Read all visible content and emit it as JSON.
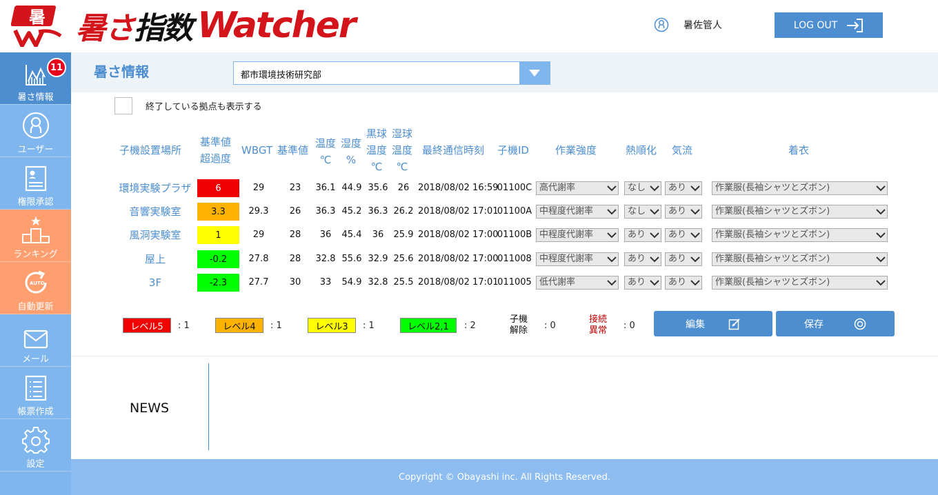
{
  "header": {
    "logo_kanji_red1": "暑",
    "logo_kana": "さ",
    "logo_kanji_black": "指数",
    "logo_en": "Watcher",
    "user_name": "暑佐管人",
    "logout_label": "LOG OUT"
  },
  "sidebar": {
    "items": [
      {
        "label": "暑さ情報",
        "badge": "11",
        "icon": "chart-icon"
      },
      {
        "label": "ユーザー",
        "icon": "user-icon"
      },
      {
        "label": "権限承認",
        "icon": "document-icon"
      },
      {
        "label": "ランキング",
        "icon": "podium-icon"
      },
      {
        "label": "自動更新",
        "icon": "auto-refresh-icon"
      },
      {
        "label": "メール",
        "icon": "mail-icon"
      },
      {
        "label": "帳票作成",
        "icon": "list-icon"
      },
      {
        "label": "設定",
        "icon": "gear-icon"
      }
    ]
  },
  "page": {
    "title": "暑さ情報",
    "site_select_value": "都市環境技術研究部",
    "show_ended_label": "終了している拠点も表示する"
  },
  "table": {
    "headers": {
      "location": "子機設置場所",
      "exceed_1": "基準値",
      "exceed_2": "超過度",
      "wbgt": "WBGT",
      "standard": "基準値",
      "temp_1": "温度",
      "temp_2": "℃",
      "humidity_1": "湿度",
      "humidity_2": "%",
      "globe_1": "黒球",
      "globe_2": "温度",
      "globe_3": "℃",
      "wet_1": "湿球",
      "wet_2": "温度",
      "wet_3": "℃",
      "last_comm": "最終通信時刻",
      "unit_id": "子機ID",
      "work_intensity": "作業強度",
      "acclimatization": "熱順化",
      "airflow": "気流",
      "clothing": "着衣"
    },
    "rows": [
      {
        "location": "環境実験プラザ",
        "exceed": "6",
        "level": "red",
        "wbgt": "29",
        "standard": "23",
        "temp": "36.1",
        "humidity": "44.9",
        "globe": "35.6",
        "wet": "26",
        "time": "2018/08/02 16:59",
        "id": "01100C",
        "intensity": "高代謝率",
        "acclim": "なし",
        "airflow": "あり",
        "clothing": "作業服(長袖シャツとズボン)"
      },
      {
        "location": "音響実験室",
        "exceed": "3.3",
        "level": "orange",
        "wbgt": "29.3",
        "standard": "26",
        "temp": "36.3",
        "humidity": "45.2",
        "globe": "36.3",
        "wet": "26.2",
        "time": "2018/08/02 17:01",
        "id": "01100A",
        "intensity": "中程度代謝率",
        "acclim": "なし",
        "airflow": "あり",
        "clothing": "作業服(長袖シャツとズボン)"
      },
      {
        "location": "風洞実験室",
        "exceed": "1",
        "level": "yellow",
        "wbgt": "29",
        "standard": "28",
        "temp": "36",
        "humidity": "45.4",
        "globe": "36",
        "wet": "25.9",
        "time": "2018/08/02 17:00",
        "id": "01100B",
        "intensity": "中程度代謝率",
        "acclim": "あり",
        "airflow": "あり",
        "clothing": "作業服(長袖シャツとズボン)"
      },
      {
        "location": "屋上",
        "exceed": "-0.2",
        "level": "green",
        "wbgt": "27.8",
        "standard": "28",
        "temp": "32.8",
        "humidity": "55.6",
        "globe": "32.9",
        "wet": "25.6",
        "time": "2018/08/02 17:00",
        "id": "011008",
        "intensity": "中程度代謝率",
        "acclim": "あり",
        "airflow": "あり",
        "clothing": "作業服(長袖シャツとズボン)"
      },
      {
        "location": "3F",
        "exceed": "-2.3",
        "level": "green",
        "wbgt": "27.7",
        "standard": "30",
        "temp": "33",
        "humidity": "54.9",
        "globe": "32.8",
        "wet": "25.5",
        "time": "2018/08/02 17:01",
        "id": "011005",
        "intensity": "低代謝率",
        "acclim": "あり",
        "airflow": "あり",
        "clothing": "作業服(長袖シャツとズボン)"
      }
    ]
  },
  "legend": {
    "level5": {
      "label": "レベル5",
      "count": ": 1",
      "color": "#f00000"
    },
    "level4": {
      "label": "レベル4",
      "count": ": 1",
      "color": "#ffb300"
    },
    "level3": {
      "label": "レベル3",
      "count": ": 1",
      "color": "#ffff00"
    },
    "level21": {
      "label": "レベル2,1",
      "count": ": 2",
      "color": "#00ff00"
    },
    "released": {
      "label_1": "子機",
      "label_2": "解除",
      "count": ": 0"
    },
    "conn_error": {
      "label_1": "接続",
      "label_2": "異常",
      "count": ": 0"
    }
  },
  "actions": {
    "edit_label": "編集",
    "save_label": "保存"
  },
  "news": {
    "label": "NEWS"
  },
  "footer": {
    "copyright": "Copyright © Obayashi inc. All Rights Reserved."
  },
  "colors": {
    "accent": "#4d8ed0",
    "sidebar": "#7fb6ee",
    "sidebar_orange": "#ff9e6e",
    "logo_red": "#d4141b"
  }
}
